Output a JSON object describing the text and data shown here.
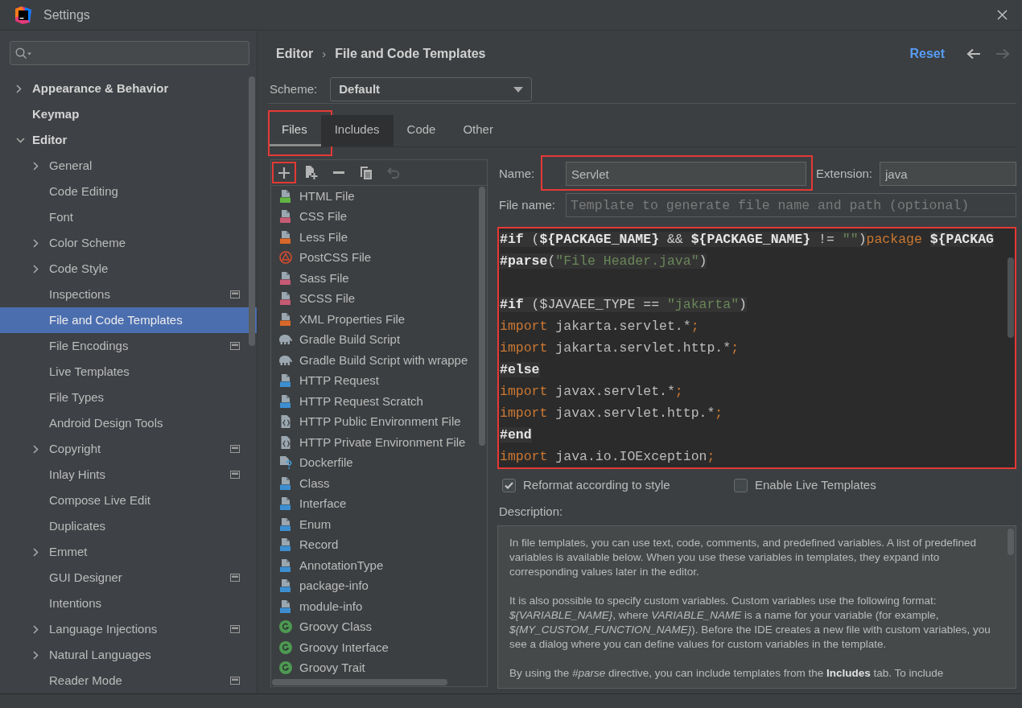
{
  "window": {
    "title": "Settings"
  },
  "sidebar": {
    "items": [
      {
        "label": "Appearance & Behavior",
        "expanded": false,
        "selected": false,
        "badge": false
      },
      {
        "label": "Keymap",
        "selected": false,
        "badge": false
      },
      {
        "label": "Editor",
        "expanded": true,
        "selected": false,
        "badge": false,
        "children": [
          {
            "label": "General",
            "expanded": false,
            "selected": false,
            "badge": false
          },
          {
            "label": "Code Editing",
            "selected": false,
            "badge": false
          },
          {
            "label": "Font",
            "selected": false,
            "badge": false
          },
          {
            "label": "Color Scheme",
            "expanded": false,
            "selected": false,
            "badge": false
          },
          {
            "label": "Code Style",
            "expanded": false,
            "selected": false,
            "badge": false
          },
          {
            "label": "Inspections",
            "selected": false,
            "badge": true
          },
          {
            "label": "File and Code Templates",
            "selected": true,
            "badge": false
          },
          {
            "label": "File Encodings",
            "selected": false,
            "badge": true
          },
          {
            "label": "Live Templates",
            "selected": false,
            "badge": false
          },
          {
            "label": "File Types",
            "selected": false,
            "badge": false
          },
          {
            "label": "Android Design Tools",
            "selected": false,
            "badge": false
          },
          {
            "label": "Copyright",
            "expanded": false,
            "selected": false,
            "badge": true
          },
          {
            "label": "Inlay Hints",
            "selected": false,
            "badge": true
          },
          {
            "label": "Compose Live Edit",
            "selected": false,
            "badge": false
          },
          {
            "label": "Duplicates",
            "selected": false,
            "badge": false
          },
          {
            "label": "Emmet",
            "expanded": false,
            "selected": false,
            "badge": false
          },
          {
            "label": "GUI Designer",
            "selected": false,
            "badge": true
          },
          {
            "label": "Intentions",
            "selected": false,
            "badge": false
          },
          {
            "label": "Language Injections",
            "expanded": false,
            "selected": false,
            "badge": true
          },
          {
            "label": "Natural Languages",
            "expanded": false,
            "selected": false,
            "badge": false
          },
          {
            "label": "Reader Mode",
            "selected": false,
            "badge": true
          }
        ]
      }
    ]
  },
  "header": {
    "breadcrumb": {
      "items": [
        "Editor",
        "File and Code Templates"
      ],
      "separator": "›"
    },
    "reset": "Reset",
    "navigation": [
      {
        "kind": "back",
        "disabled": false
      },
      {
        "kind": "forward",
        "disabled": true
      }
    ]
  },
  "scheme": {
    "label": "Scheme:",
    "value": "Default"
  },
  "tabs": [
    {
      "label": "Files",
      "selected": true,
      "hovered": false,
      "highlighted": true
    },
    {
      "label": "Includes",
      "selected": false,
      "hovered": true,
      "highlighted": false
    },
    {
      "label": "Code",
      "selected": false,
      "hovered": false,
      "highlighted": false
    },
    {
      "label": "Other",
      "selected": false,
      "hovered": false,
      "highlighted": false
    }
  ],
  "toolbar": [
    {
      "kind": "add",
      "disabled": false,
      "highlighted": true
    },
    {
      "kind": "insert",
      "disabled": false,
      "highlighted": false
    },
    {
      "kind": "remove",
      "disabled": false,
      "highlighted": false
    },
    {
      "kind": "copy",
      "disabled": false,
      "highlighted": false
    },
    {
      "kind": "revert",
      "disabled": true,
      "highlighted": false
    }
  ],
  "templates": [
    {
      "label": "HTML File",
      "kind": "html",
      "selected": false
    },
    {
      "label": "CSS File",
      "kind": "css",
      "selected": false
    },
    {
      "label": "Less File",
      "kind": "less",
      "selected": false
    },
    {
      "label": "PostCSS File",
      "kind": "postcss",
      "selected": false
    },
    {
      "label": "Sass File",
      "kind": "sass",
      "selected": false
    },
    {
      "label": "SCSS File",
      "kind": "sass",
      "selected": false
    },
    {
      "label": "XML Properties File",
      "kind": "xml",
      "selected": false
    },
    {
      "label": "Gradle Build Script",
      "kind": "gradle",
      "selected": false
    },
    {
      "label": "Gradle Build Script with wrappe",
      "kind": "gradle",
      "selected": false
    },
    {
      "label": "HTTP Request",
      "kind": "api",
      "selected": false
    },
    {
      "label": "HTTP Request Scratch",
      "kind": "api",
      "selected": false
    },
    {
      "label": "HTTP Public Environment File",
      "kind": "env",
      "selected": false
    },
    {
      "label": "HTTP Private Environment File",
      "kind": "env",
      "selected": false
    },
    {
      "label": "Dockerfile",
      "kind": "docker",
      "selected": false
    },
    {
      "label": "Class",
      "kind": "java",
      "selected": false
    },
    {
      "label": "Interface",
      "kind": "java",
      "selected": false
    },
    {
      "label": "Enum",
      "kind": "java",
      "selected": false
    },
    {
      "label": "Record",
      "kind": "java",
      "selected": false
    },
    {
      "label": "AnnotationType",
      "kind": "java",
      "selected": false
    },
    {
      "label": "package-info",
      "kind": "java",
      "selected": false
    },
    {
      "label": "module-info",
      "kind": "java",
      "selected": false
    },
    {
      "label": "Groovy Class",
      "kind": "groovy",
      "selected": false
    },
    {
      "label": "Groovy Interface",
      "kind": "groovy",
      "selected": false
    },
    {
      "label": "Groovy Trait",
      "kind": "groovy",
      "selected": false
    }
  ],
  "name_field": {
    "label": "Name:",
    "value": "Servlet",
    "highlighted": true
  },
  "extension_field": {
    "label": "Extension:",
    "value": "java"
  },
  "file_name_field": {
    "label": "File name:",
    "placeholder": "Template to generate file name and path (optional)"
  },
  "editor": {
    "highlighted": true,
    "lines": [
      {
        "kind": "code",
        "tokens": [
          {
            "kind": "directive",
            "text": "#if"
          },
          {
            "kind": "tpl",
            "text": " ("
          },
          {
            "kind": "variable",
            "text": "${PACKAGE_NAME}"
          },
          {
            "kind": "tpl",
            "text": " && "
          },
          {
            "kind": "variable",
            "text": "${PACKAGE_NAME}"
          },
          {
            "kind": "tpl",
            "text": " != "
          },
          {
            "kind": "tstring",
            "text": "\"\""
          },
          {
            "kind": "tpl",
            "text": ")"
          },
          {
            "kind": "keyword",
            "text": "package "
          },
          {
            "kind": "variable",
            "text": "${PACKAG"
          }
        ]
      },
      {
        "kind": "code",
        "tokens": [
          {
            "kind": "directive",
            "text": "#parse"
          },
          {
            "kind": "tpl",
            "text": "("
          },
          {
            "kind": "tstring",
            "text": "\"File Header.java\""
          },
          {
            "kind": "tpl",
            "text": ")"
          }
        ]
      },
      {
        "kind": "blank"
      },
      {
        "kind": "code",
        "tokens": [
          {
            "kind": "directive",
            "text": "#if"
          },
          {
            "kind": "tpl",
            "text": " ($JAVAEE_TYPE == "
          },
          {
            "kind": "tstring",
            "text": "\"jakarta\""
          },
          {
            "kind": "tpl",
            "text": ")"
          }
        ]
      },
      {
        "kind": "code",
        "tokens": [
          {
            "kind": "keyword",
            "text": "import"
          },
          {
            "kind": "plain",
            "text": " jakarta.servlet.*"
          },
          {
            "kind": "semicolon",
            "text": ";"
          }
        ]
      },
      {
        "kind": "code",
        "tokens": [
          {
            "kind": "keyword",
            "text": "import"
          },
          {
            "kind": "plain",
            "text": " jakarta.servlet.http.*"
          },
          {
            "kind": "semicolon",
            "text": ";"
          }
        ]
      },
      {
        "kind": "code",
        "tokens": [
          {
            "kind": "directive",
            "text": "#else"
          }
        ]
      },
      {
        "kind": "code",
        "tokens": [
          {
            "kind": "keyword",
            "text": "import"
          },
          {
            "kind": "plain",
            "text": " javax.servlet.*"
          },
          {
            "kind": "semicolon",
            "text": ";"
          }
        ]
      },
      {
        "kind": "code",
        "tokens": [
          {
            "kind": "keyword",
            "text": "import"
          },
          {
            "kind": "plain",
            "text": " javax.servlet.http.*"
          },
          {
            "kind": "semicolon",
            "text": ";"
          }
        ]
      },
      {
        "kind": "code",
        "tokens": [
          {
            "kind": "directive",
            "text": "#end"
          }
        ]
      },
      {
        "kind": "code",
        "tokens": [
          {
            "kind": "keyword",
            "text": "import"
          },
          {
            "kind": "plain",
            "text": " java.io.IOException"
          },
          {
            "kind": "semicolon",
            "text": ";"
          }
        ]
      }
    ]
  },
  "options": [
    {
      "label": "Reformat according to style",
      "checked": true
    },
    {
      "label": "Enable Live Templates",
      "checked": false
    }
  ],
  "description": {
    "label": "Description:",
    "paragraphs": [
      "In file templates, you can use text, code, comments, and predefined variables. A list of predefined variables is available below. When you use these variables in templates, they expand into corresponding values later in the editor.",
      "It is also possible to specify custom variables. Custom variables use the following format: *${VARIABLE_NAME}*, where *VARIABLE_NAME* is a name for your variable (for example, *${MY_CUSTOM_FUNCTION_NAME}*). Before the IDE creates a new file with custom variables, you see a dialog where you can define values for custom variables in the template.",
      "By using the *#parse* directive, you can include templates from the **Includes** tab. To include"
    ]
  }
}
